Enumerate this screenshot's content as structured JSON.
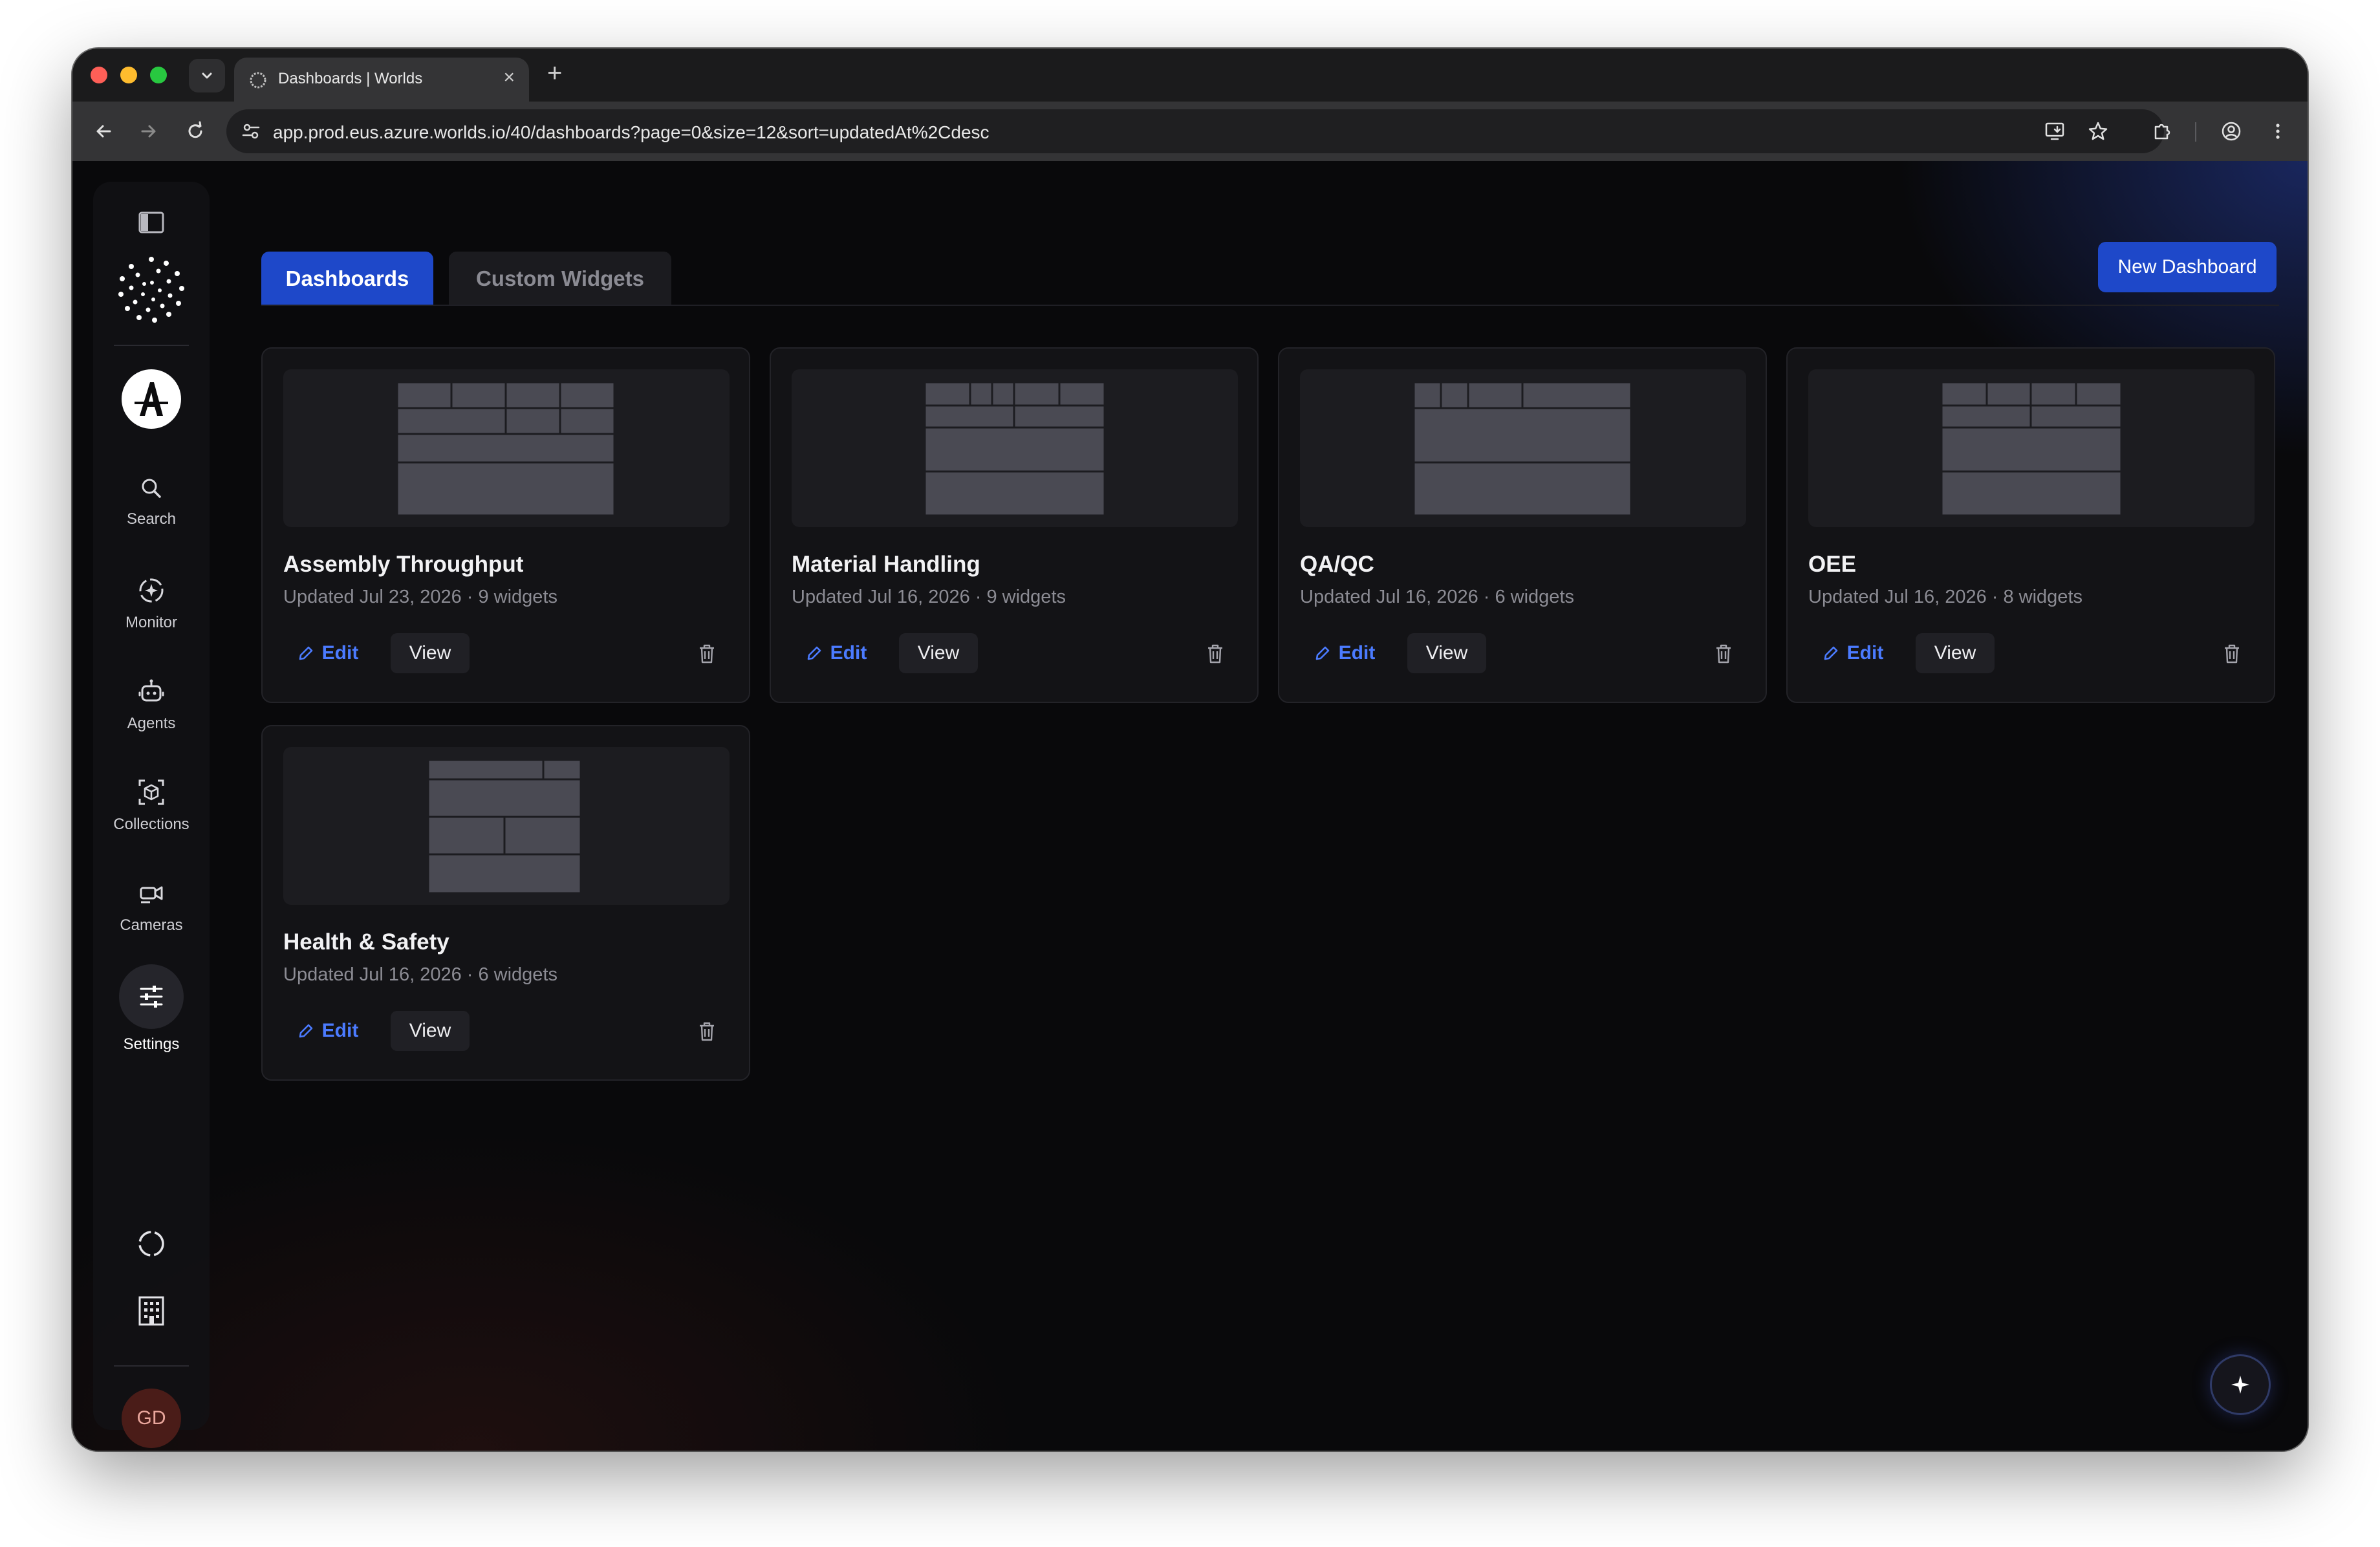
{
  "browser": {
    "tab_title": "Dashboards | Worlds",
    "tab_close": "×",
    "new_tab": "+",
    "url": "app.prod.eus.azure.worlds.io/40/dashboards?page=0&size=12&sort=updatedAt%2Cdesc"
  },
  "sidebar": {
    "items": [
      {
        "label": "Search",
        "icon": "search-icon"
      },
      {
        "label": "Monitor",
        "icon": "monitor-icon"
      },
      {
        "label": "Agents",
        "icon": "robot-icon"
      },
      {
        "label": "Collections",
        "icon": "cube-icon"
      },
      {
        "label": "Cameras",
        "icon": "camera-icon"
      },
      {
        "label": "Settings",
        "icon": "sliders-icon"
      }
    ],
    "avatar_initials": "GD"
  },
  "tabs": {
    "dashboards": "Dashboards",
    "custom_widgets": "Custom Widgets"
  },
  "header": {
    "new_dashboard_label": "New Dashboard"
  },
  "cards": [
    {
      "title": "Assembly Throughput",
      "meta": "Updated Jul 23, 2026 · 9 widgets",
      "edit": "Edit",
      "view": "View"
    },
    {
      "title": "Material Handling",
      "meta": "Updated Jul 16, 2026 · 9 widgets",
      "edit": "Edit",
      "view": "View"
    },
    {
      "title": "QA/QC",
      "meta": "Updated Jul 16, 2026 · 6 widgets",
      "edit": "Edit",
      "view": "View"
    },
    {
      "title": "OEE",
      "meta": "Updated Jul 16, 2026 · 8 widgets",
      "edit": "Edit",
      "view": "View"
    },
    {
      "title": "Health & Safety",
      "meta": "Updated Jul 16, 2026 · 6 widgets",
      "edit": "Edit",
      "view": "View"
    }
  ],
  "colors": {
    "accent": "#1e48c9",
    "edit_link": "#4b7bff",
    "background": "#09090b"
  }
}
